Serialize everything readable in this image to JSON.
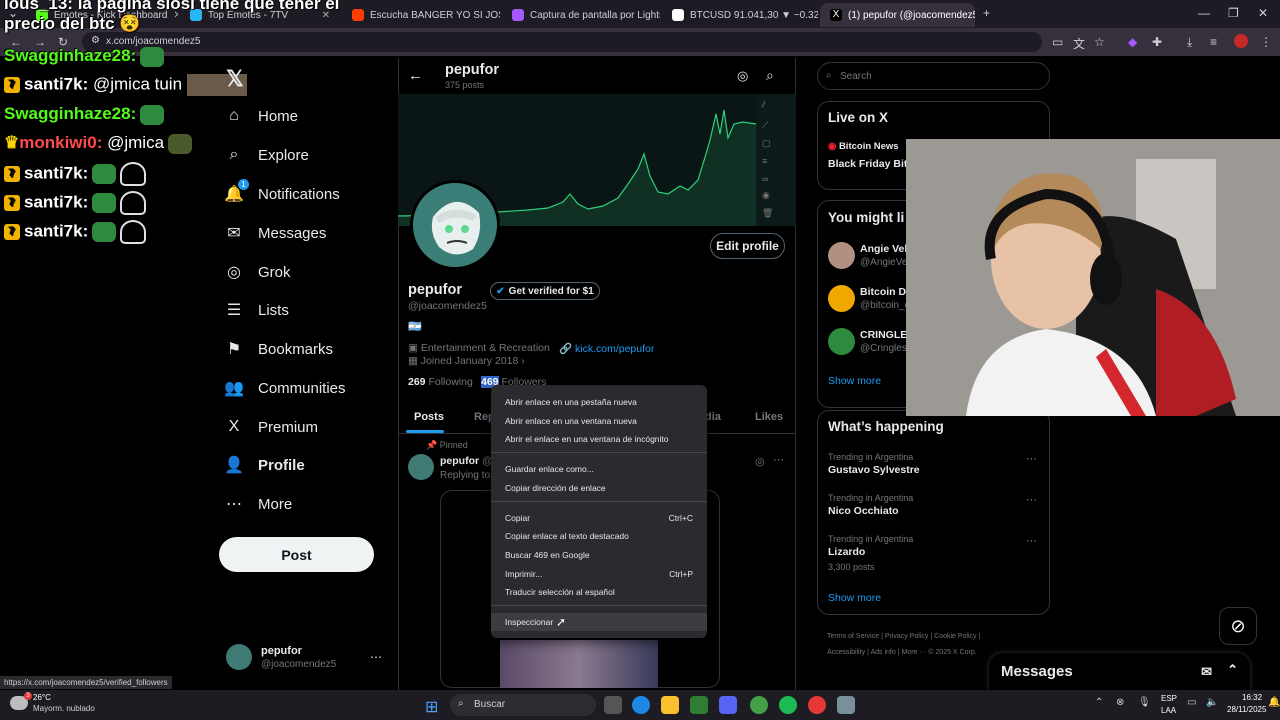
{
  "browser": {
    "tabs": [
      {
        "label": "Emotes - Kick Dashboard",
        "color": "#53fc18"
      },
      {
        "label": "Top Emotes - 7TV",
        "color": "#29b6f6"
      },
      {
        "label": "Escucha BANGER YO SI JOSEO",
        "color": "#ff3d00"
      },
      {
        "label": "Captura de pantalla por Lightsh",
        "color": "#a259ff"
      },
      {
        "label": "BTCUSD 91.041,30 ▼ −0.32% S",
        "color": "#ffffff"
      },
      {
        "label": "(1) pepufor (@joacomendez5) /",
        "color": "#ffffff"
      }
    ],
    "url": "x.com/joacomendez5",
    "status_url": "https://x.com/joacomendez5/verified_followers"
  },
  "chat": {
    "header_line": "lous_13: la pagina siosi tiene que tener el",
    "header_line2": "precio del btc",
    "lines": [
      {
        "user": "Swagginhaze28:",
        "text": "",
        "color": "#53fc18",
        "badge": false
      },
      {
        "user": "santi7k:",
        "text": "@jmica tuin",
        "color": "#ffffff",
        "badge": true
      },
      {
        "user": "Swagginhaze28:",
        "text": "",
        "color": "#53fc18",
        "badge": false
      },
      {
        "user": "monkiwi0:",
        "text": "@jmica",
        "color": "#ff4b4b",
        "badge": false
      },
      {
        "user": "santi7k:",
        "text": "",
        "color": "#ffffff",
        "badge": true
      },
      {
        "user": "santi7k:",
        "text": "",
        "color": "#ffffff",
        "badge": true
      },
      {
        "user": "santi7k:",
        "text": "",
        "color": "#ffffff",
        "badge": true
      }
    ]
  },
  "nav": {
    "items": [
      {
        "label": "Home",
        "icon": "⌂"
      },
      {
        "label": "Explore",
        "icon": "⌕"
      },
      {
        "label": "Notifications",
        "icon": "🔔"
      },
      {
        "label": "Messages",
        "icon": "✉"
      },
      {
        "label": "Grok",
        "icon": "◎"
      },
      {
        "label": "Lists",
        "icon": "☰"
      },
      {
        "label": "Bookmarks",
        "icon": "⚑"
      },
      {
        "label": "Communities",
        "icon": "👥"
      },
      {
        "label": "Premium",
        "icon": "X"
      },
      {
        "label": "Profile",
        "icon": "👤"
      },
      {
        "label": "More",
        "icon": "⋯"
      }
    ],
    "notification_count": "1",
    "post_label": "Post",
    "account_name": "pepufor",
    "account_handle": "@joacomendez5"
  },
  "profile": {
    "header_name": "pepufor",
    "header_posts": "375 posts",
    "name": "pepufor",
    "verify_label": "Get verified for $1",
    "handle": "@joacomendez5",
    "flag": "🇦🇷",
    "category": "Entertainment & Recreation",
    "link": "kick.com/pepufor",
    "joined": "Joined January 2018",
    "following_count": "269",
    "following_label": "Following",
    "followers_count": "469",
    "followers_label": "Followers",
    "edit_label": "Edit profile",
    "tabs": [
      "Posts",
      "Rep",
      "dia",
      "Likes"
    ],
    "pinned_label": "Pinned",
    "post_author": "pepufor",
    "post_handle": "@j",
    "replying_label": "Replying to"
  },
  "context_menu": {
    "items": [
      {
        "label": "Abrir enlace en una pestaña nueva",
        "shortcut": ""
      },
      {
        "label": "Abrir enlace en una ventana nueva",
        "shortcut": ""
      },
      {
        "label": "Abrir el enlace en una ventana de incógnito",
        "shortcut": ""
      },
      {
        "label": "Guardar enlace como...",
        "shortcut": ""
      },
      {
        "label": "Copiar dirección de enlace",
        "shortcut": ""
      },
      {
        "label": "Copiar",
        "shortcut": "Ctrl+C"
      },
      {
        "label": "Copiar enlace al texto destacado",
        "shortcut": ""
      },
      {
        "label": "Buscar 469 en Google",
        "shortcut": ""
      },
      {
        "label": "Imprimir...",
        "shortcut": "Ctrl+P"
      },
      {
        "label": "Traducir selección al español",
        "shortcut": ""
      },
      {
        "label": "Inspeccionar",
        "shortcut": ""
      }
    ]
  },
  "right": {
    "search_placeholder": "Search",
    "live_title": "Live on X",
    "live_source": "Bitcoin News",
    "live_text": "Black Friday Bitc",
    "might_like_title": "You might li",
    "suggestions": [
      {
        "name": "Angie Vel",
        "handle": "@AngieVe"
      },
      {
        "name": "Bitcoin Da",
        "handle": "@bitcoin_d"
      },
      {
        "name": "CRINGLES",
        "handle": "@Cringles"
      }
    ],
    "show_more": "Show more",
    "happening_title": "What’s happening",
    "trends": [
      {
        "context": "Trending in Argentina",
        "name": "Gustavo Sylvestre",
        "posts": ""
      },
      {
        "context": "Trending in Argentina",
        "name": "Nico Occhiato",
        "posts": ""
      },
      {
        "context": "Trending in Argentina",
        "name": "Lizardo",
        "posts": "3,300 posts"
      }
    ],
    "show_more2": "Show more",
    "footer": [
      "Terms of Service",
      "Privacy Policy",
      "Cookie Policy",
      "Accessibility",
      "Ads info",
      "More ···",
      "© 2025 X Corp."
    ],
    "messages_label": "Messages"
  },
  "taskbar": {
    "weather_temp": "26°C",
    "weather_desc": "Mayorm. nublado",
    "search": "Buscar",
    "lang": "ESP",
    "lang2": "LAA",
    "time": "16:32",
    "date": "28/11/2025"
  },
  "colors": {
    "accent": "#1d9bf0",
    "chart_green": "#2fd17a",
    "kick_green": "#53fc18"
  }
}
